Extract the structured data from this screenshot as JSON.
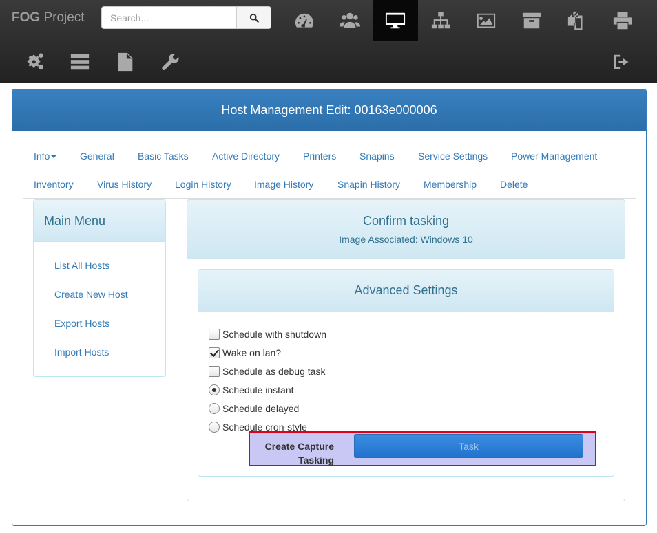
{
  "brand": {
    "bold": "FOG",
    "rest": " Project"
  },
  "search": {
    "placeholder": "Search..."
  },
  "nav_icons": [
    "dashboard-icon",
    "users-icon",
    "desktop-icon",
    "sitemap-icon",
    "image-icon",
    "archive-icon",
    "copy-icon",
    "print-icon",
    "cogs-icon",
    "server-icon",
    "file-icon",
    "wrench-icon",
    "logout-icon"
  ],
  "active_nav": "desktop-icon",
  "page": {
    "title": "Host Management Edit: 00163e000006"
  },
  "tabs": {
    "row1": [
      "Info",
      "General",
      "Basic Tasks",
      "Active Directory",
      "Printers",
      "Snapins",
      "Service Settings",
      "Power Management"
    ],
    "row2": [
      "Inventory",
      "Virus History",
      "Login History",
      "Image History",
      "Snapin History",
      "Membership",
      "Delete"
    ]
  },
  "side_menu": {
    "title": "Main Menu",
    "items": [
      "List All Hosts",
      "Create New Host",
      "Export Hosts",
      "Import Hosts"
    ]
  },
  "confirm": {
    "title": "Confirm tasking",
    "subtitle": "Image Associated: Windows 10"
  },
  "advanced": {
    "title": "Advanced Settings",
    "options": [
      {
        "label": "Schedule with shutdown",
        "type": "checkbox",
        "checked": false
      },
      {
        "label": "Wake on lan?",
        "type": "checkbox",
        "checked": true
      },
      {
        "label": "Schedule as debug task",
        "type": "checkbox",
        "checked": false
      },
      {
        "label": "Schedule instant",
        "type": "radio",
        "checked": true
      },
      {
        "label": "Schedule delayed",
        "type": "radio",
        "checked": false
      },
      {
        "label": "Schedule cron-style",
        "type": "radio",
        "checked": false
      }
    ]
  },
  "capture": {
    "label_line1": "Create Capture",
    "label_line2": "Tasking",
    "button": "Task"
  },
  "colors": {
    "navbar": "#222222",
    "primary": "#337ab7",
    "info_border": "#bce8f1",
    "highlight_border": "#e0001b",
    "highlight_bg": "#c9c8f5"
  }
}
